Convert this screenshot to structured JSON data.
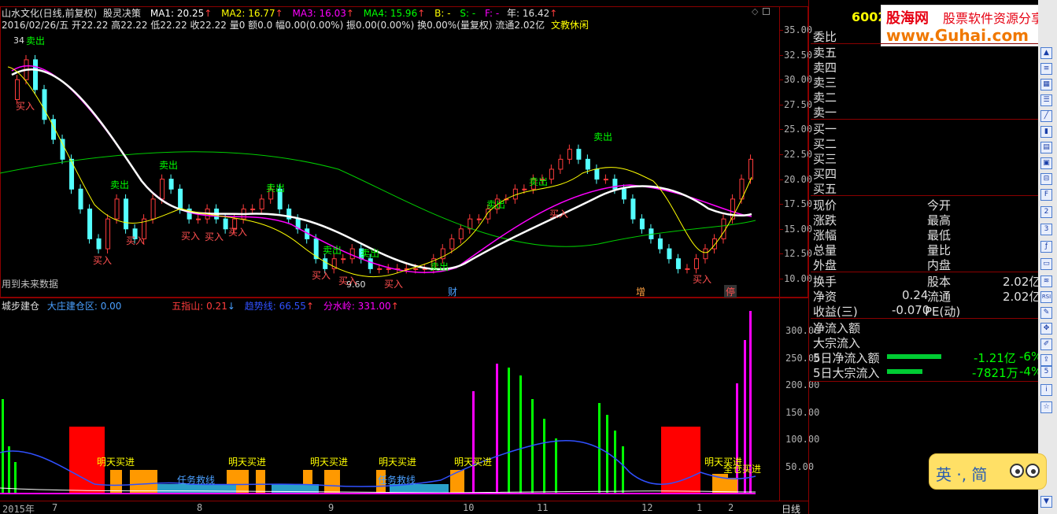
{
  "header": {
    "title": "山水文化(日线,前复权)",
    "indicator": "股灵决策",
    "ma1": "MA1: 20.25",
    "ma2": "MA2: 16.77",
    "ma3": "MA3: 16.03",
    "ma4": "MA4: 15.96",
    "b": "B: -",
    "s": "S: -",
    "f": "F: -",
    "year": "年: 16.42",
    "arrow": "↑",
    "info": "2016/02/26/五 开22.22 高22.22 低22.22 收22.22 量0 额0.0 幅0.00(0.00%) 振0.00(0.00%) 换0.00%(量复权) 流通2.02亿",
    "sector": "文教休闲"
  },
  "colors": {
    "up": "#ff3c3c",
    "down": "#54ffff",
    "ma1": "#ffffff",
    "ma2": "#ffff00",
    "ma3": "#ff00ff",
    "ma4": "#00ff00",
    "panel_border": "#8b0000"
  },
  "main_chart": {
    "y_ticks": [
      "35.00",
      "32.50",
      "30.00",
      "27.50",
      "25.00",
      "22.50",
      "20.00",
      "17.50",
      "15.00",
      "12.50",
      "10.00"
    ],
    "labels": {
      "high": "34",
      "low": "9.60",
      "future": "用到未来数据",
      "sell": "卖出",
      "buy": "买入",
      "cai": "财",
      "zeng": "增",
      "ting": "停"
    }
  },
  "sub_chart": {
    "title": "城步建仓",
    "zone": "大庄建仓区: 0.00",
    "wzs": "五指山: 0.21",
    "trend": "趋势线: 66.55",
    "fsl": "分水岭: 331.00",
    "y_ticks": [
      "300.00",
      "250.00",
      "200.00",
      "150.00",
      "100.00",
      "50.00"
    ],
    "labels": {
      "buy_tomorrow": "明天买进",
      "rescue": "任务救线",
      "all_buy": "全仓买进"
    }
  },
  "x_axis": {
    "labels": [
      "2015年",
      "7",
      "8",
      "9",
      "10",
      "11",
      "12",
      "1",
      "2"
    ],
    "period": "日线"
  },
  "quote": {
    "code": "6002",
    "labels": {
      "weibi": "委比",
      "sell5": "卖五",
      "sell4": "卖四",
      "sell3": "卖三",
      "sell2": "卖二",
      "sell1": "卖一",
      "buy1": "买一",
      "buy2": "买二",
      "buy3": "买三",
      "buy4": "买四",
      "buy5": "买五",
      "xianjia": "现价",
      "jinkai": "今开",
      "zhangdie": "涨跌",
      "zuigao": "最高",
      "zhangfu": "涨幅",
      "zuidi": "最低",
      "zongliang": "总量",
      "liangbi": "量比",
      "waipan": "外盘",
      "neipan": "内盘",
      "huanshou": "换手",
      "guben": "股本",
      "jingzi": "净资",
      "liutong": "流通",
      "shouyi": "收益(三)",
      "pe": "PE(动)"
    },
    "values": {
      "guben": "2.02亿",
      "jingzi": "0.24",
      "liutong": "2.02亿",
      "shouyi": "-0.070"
    },
    "flows": {
      "net_inflow": "净流入额",
      "big_inflow": "大宗流入",
      "net5": "5日净流入额",
      "big5": "5日大宗流入",
      "net5_val": "-1.21亿",
      "net5_pct": "-6%",
      "big5_val": "-7821万",
      "big5_pct": "-4%"
    }
  },
  "watermark": {
    "brand": "股海网",
    "slogan": "股票软件资源分享",
    "url": "www.Guhai.com"
  },
  "ime": {
    "text": "英 ·, 简"
  }
}
